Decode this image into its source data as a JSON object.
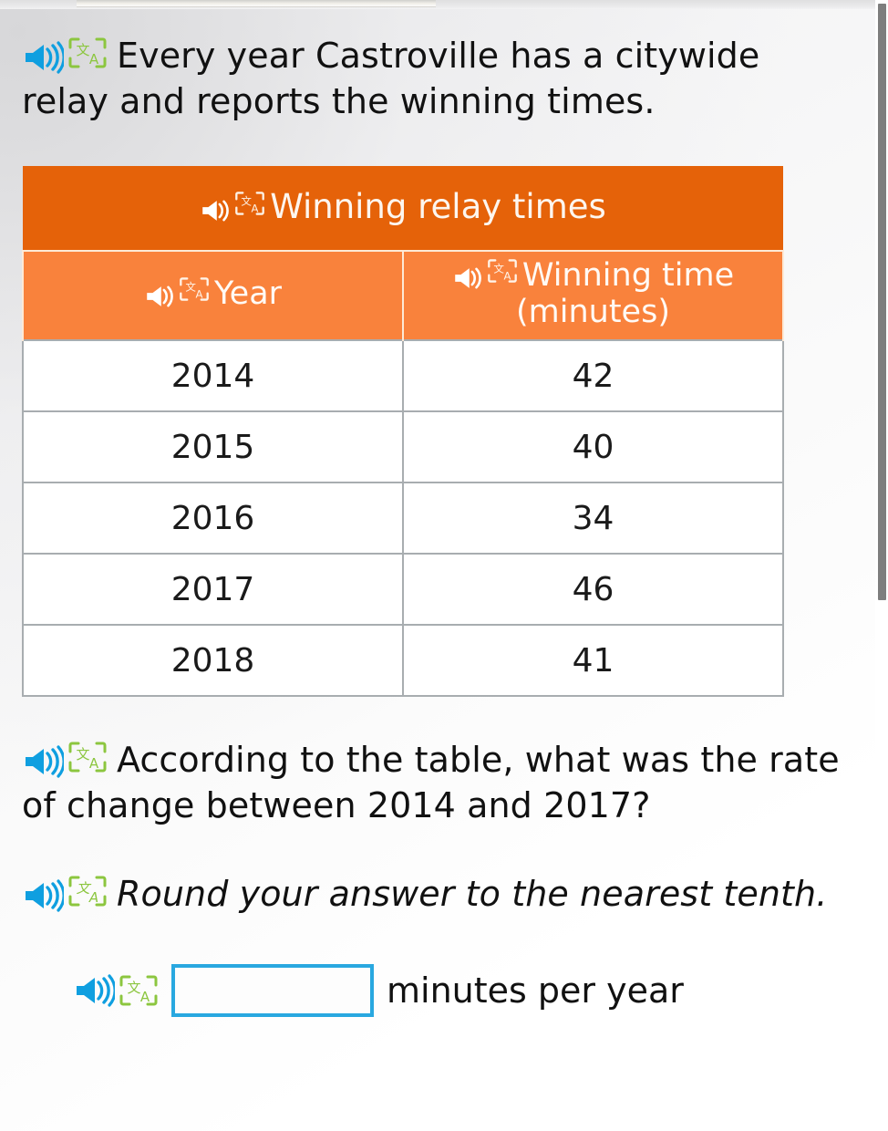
{
  "icons": {
    "speaker": "speaker-audio-icon",
    "translate": "translate-icon"
  },
  "colors": {
    "speaker_blue": "#0f9fe0",
    "translate_green": "#8cc63f",
    "table_title_orange": "#e56209",
    "table_header_orange": "#f9823c",
    "input_border_blue": "#29a8e0",
    "cell_border_gray": "#a8adb0"
  },
  "prompt": {
    "intro": "Every year Castroville has a citywide relay and reports the winning times.",
    "question": "According to the table, what was the rate of change between 2014 and 2017?",
    "rounding": "Round your answer to the nearest tenth."
  },
  "table": {
    "title": "Winning relay times",
    "columns": [
      "Year",
      "Winning time (minutes)"
    ],
    "rows": [
      [
        "2014",
        "42"
      ],
      [
        "2015",
        "40"
      ],
      [
        "2016",
        "34"
      ],
      [
        "2017",
        "46"
      ],
      [
        "2018",
        "41"
      ]
    ]
  },
  "answer": {
    "value": "",
    "placeholder": "",
    "unit": "minutes per year"
  },
  "chart_data": {
    "type": "table",
    "title": "Winning relay times",
    "categories": [
      "2014",
      "2015",
      "2016",
      "2017",
      "2018"
    ],
    "values": [
      42,
      40,
      34,
      46,
      41
    ],
    "xlabel": "Year",
    "ylabel": "Winning time (minutes)"
  }
}
